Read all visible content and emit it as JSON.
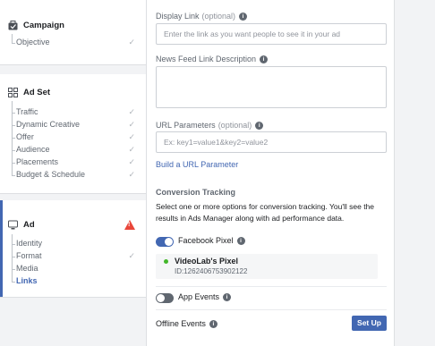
{
  "sidebar": {
    "campaign": {
      "title": "Campaign",
      "items": [
        {
          "label": "Objective",
          "done": true
        }
      ]
    },
    "adset": {
      "title": "Ad Set",
      "items": [
        {
          "label": "Traffic",
          "done": true
        },
        {
          "label": "Dynamic Creative",
          "done": true
        },
        {
          "label": "Offer",
          "done": true
        },
        {
          "label": "Audience",
          "done": true
        },
        {
          "label": "Placements",
          "done": true
        },
        {
          "label": "Budget & Schedule",
          "done": true
        }
      ]
    },
    "ad": {
      "title": "Ad",
      "warning": "!",
      "items": [
        {
          "label": "Identity",
          "done": false
        },
        {
          "label": "Format",
          "done": true
        },
        {
          "label": "Media",
          "done": false
        },
        {
          "label": "Links",
          "done": false,
          "active": true
        }
      ]
    },
    "check_glyph": "✓"
  },
  "form": {
    "display_link": {
      "label": "Display Link",
      "optional": "(optional)",
      "placeholder": "Enter the link as you want people to see it in your ad"
    },
    "news_feed": {
      "label": "News Feed Link Description"
    },
    "url_params": {
      "label": "URL Parameters",
      "optional": "(optional)",
      "placeholder": "Ex: key1=value1&key2=value2"
    },
    "build_link": "Build a URL Parameter",
    "conversion": {
      "heading": "Conversion Tracking",
      "description": "Select one or more options for conversion tracking. You'll see the results in Ads Manager along with ad performance data."
    },
    "facebook_pixel": {
      "label": "Facebook Pixel",
      "on": true,
      "pixel_name": "VideoLab's Pixel",
      "pixel_id": "ID:1262406753902122"
    },
    "app_events": {
      "label": "App Events",
      "on": false
    },
    "offline_events": {
      "label": "Offline Events",
      "button": "Set Up"
    },
    "info_glyph": "i"
  },
  "colors": {
    "accent": "#4267b2",
    "warning": "#e9463a",
    "pixel_status": "#42b72a"
  }
}
